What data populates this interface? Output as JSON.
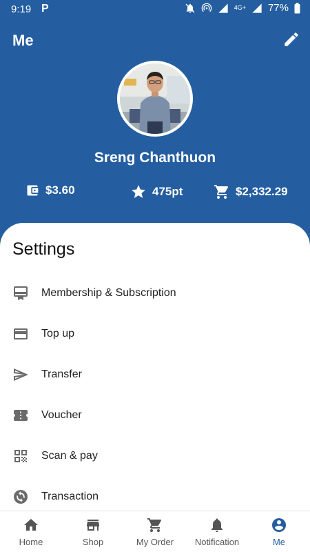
{
  "status_bar": {
    "time": "9:19",
    "app_icon": "P",
    "network_label": "4G+",
    "battery": "77%"
  },
  "header": {
    "title": "Me",
    "edit_icon": "pencil-icon"
  },
  "profile": {
    "name": "Sreng Chanthuon",
    "wallet": "$3.60",
    "points": "475pt",
    "spent": "$2,332.29"
  },
  "settings": {
    "title": "Settings",
    "items": [
      {
        "label": "Membership & Subscription",
        "icon": "membership-card-icon"
      },
      {
        "label": "Top up",
        "icon": "credit-card-icon"
      },
      {
        "label": "Transfer",
        "icon": "send-icon"
      },
      {
        "label": "Voucher",
        "icon": "ticket-icon"
      },
      {
        "label": "Scan & pay",
        "icon": "qr-code-icon"
      },
      {
        "label": "Transaction",
        "icon": "sync-icon"
      }
    ]
  },
  "bottom_nav": {
    "items": [
      {
        "label": "Home",
        "icon": "home-icon",
        "active": false
      },
      {
        "label": "Shop",
        "icon": "store-icon",
        "active": false
      },
      {
        "label": "My Order",
        "icon": "cart-icon",
        "active": false
      },
      {
        "label": "Notification",
        "icon": "bell-icon",
        "active": false
      },
      {
        "label": "Me",
        "icon": "account-circle-icon",
        "active": true
      }
    ]
  },
  "colors": {
    "primary": "#245ea0",
    "icon_gray": "#6b6b6b",
    "text": "#222222"
  }
}
